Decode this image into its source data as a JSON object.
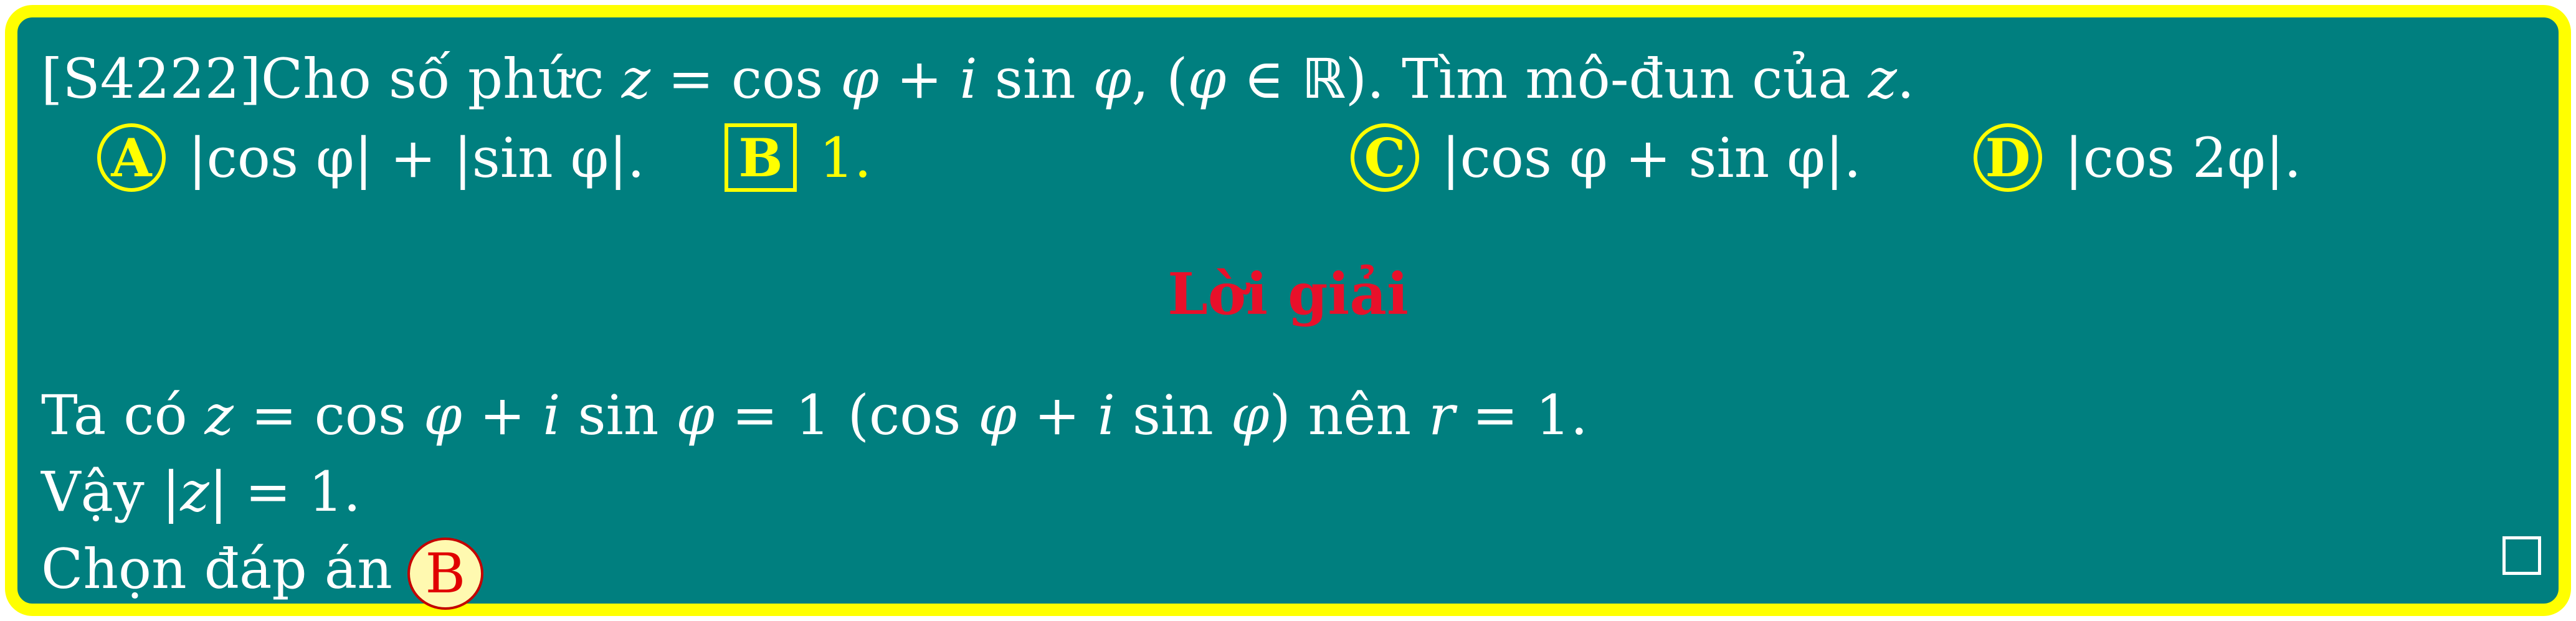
{
  "question": {
    "id": "[S4222]",
    "text_prefix": "Cho số phức ",
    "text_mid": ", ",
    "text_suffix": ". Tìm mô-đun của ",
    "end": "."
  },
  "options": [
    {
      "letter": "A",
      "text": "|cos φ| + |sin φ|."
    },
    {
      "letter": "B",
      "text": "1."
    },
    {
      "letter": "C",
      "text": "|cos φ + sin φ|."
    },
    {
      "letter": "D",
      "text": "|cos 2φ|."
    }
  ],
  "solution": {
    "heading": "Lời giải",
    "line1_prefix": "Ta có ",
    "line1_mid": " nên ",
    "line1_end": ".",
    "line2_prefix": "Vậy ",
    "line2_end": ".",
    "line3_prefix": "Chọn đáp án",
    "answer": "B"
  },
  "colors": {
    "background": "#007f7f",
    "border": "#ffff00",
    "heading": "#e8102a"
  },
  "icons": {
    "end_of_proof": "square-icon"
  }
}
